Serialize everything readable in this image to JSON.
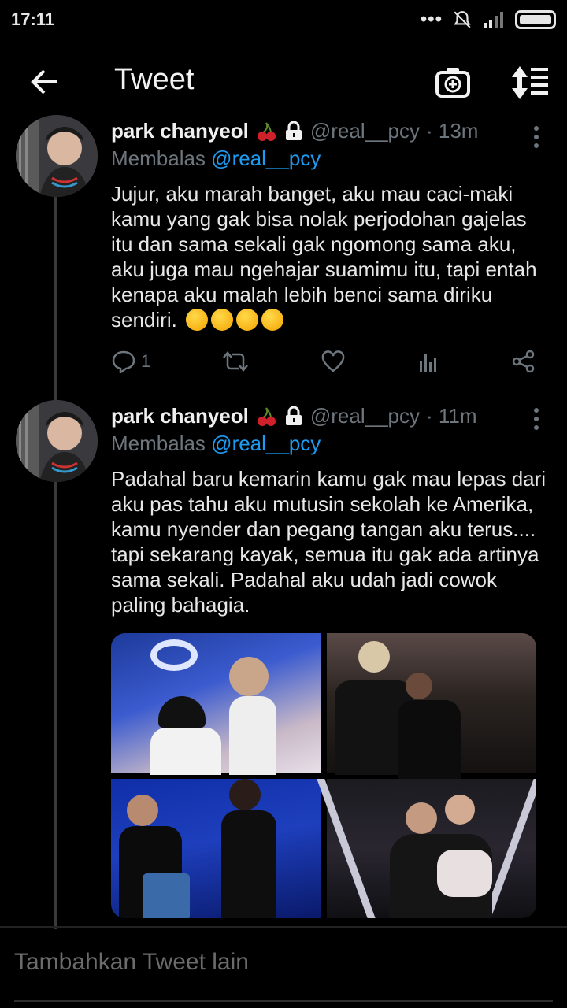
{
  "status": {
    "time": "17:11",
    "dots": "•••"
  },
  "header": {
    "title": "Tweet"
  },
  "tweets": [
    {
      "name": "park chanyeol",
      "handle": "@real__pcy",
      "time": "· 13m",
      "reply_prefix": "Membalas",
      "reply_to": "@real__pcy",
      "text": "Jujur, aku marah banget, aku mau caci-maki kamu yang gak bisa nolak perjodohan gajelas itu dan sama sekali gak ngomong sama aku, aku juga mau ngehajar suamimu itu, tapi entah kenapa aku malah lebih benci sama diriku sendiri.",
      "reply_count": "1"
    },
    {
      "name": "park chanyeol",
      "handle": "@real__pcy",
      "time": "· 11m",
      "reply_prefix": "Membalas",
      "reply_to": "@real__pcy",
      "text": "Padahal baru kemarin kamu gak mau lepas dari aku pas tahu aku mutusin sekolah ke Amerika, kamu nyender dan pegang tangan aku terus.... tapi sekarang kayak, semua itu gak ada artinya sama sekali. Padahal aku udah jadi cowok paling bahagia."
    }
  ],
  "compose": {
    "placeholder": "Tambahkan Tweet lain"
  },
  "icons": [
    "back-arrow-icon",
    "camera-plus-icon",
    "sort-icon",
    "cherry-icon",
    "lock-icon",
    "reply-icon",
    "retweet-icon",
    "like-icon",
    "analytics-icon",
    "share-icon",
    "more-icon"
  ],
  "colors": {
    "background": "#000000",
    "mention": "#1d9bf0",
    "muted": "#6e767d"
  }
}
